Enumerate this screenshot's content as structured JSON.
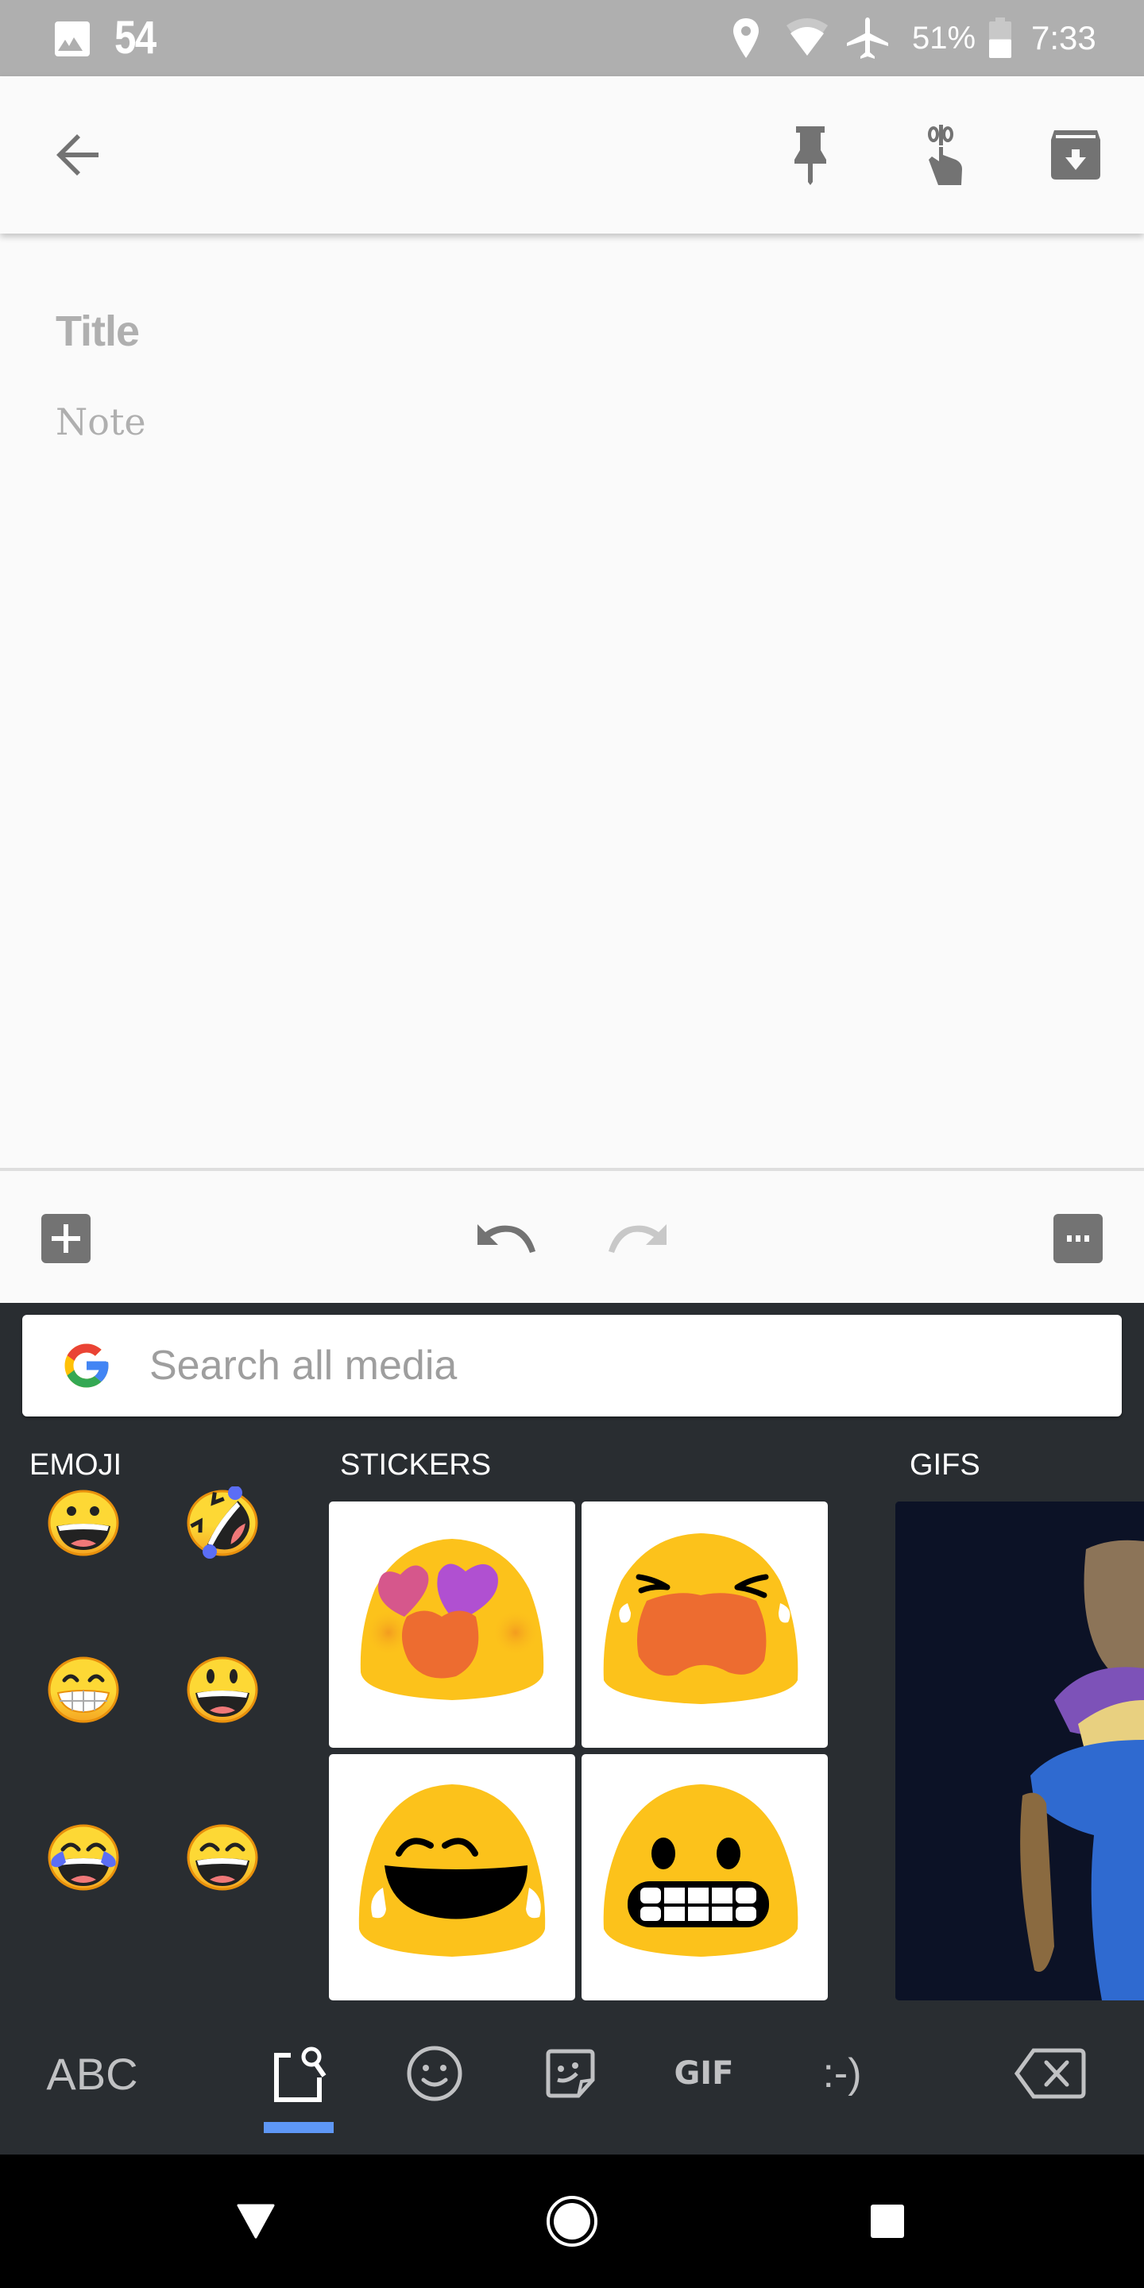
{
  "status_bar": {
    "notification_icon": "image-icon",
    "notification_count": "54",
    "icons": [
      "location-icon",
      "wifi-icon",
      "airplane-mode-icon"
    ],
    "battery_percent": "51%",
    "battery_level": 0.51,
    "time": "7:33"
  },
  "toolbar": {
    "back": "arrow-back-icon",
    "actions": [
      "pin-icon",
      "reminder-icon",
      "archive-icon"
    ]
  },
  "note": {
    "title_placeholder": "Title",
    "body_placeholder": "Note"
  },
  "action_bar": {
    "add": "add-box-icon",
    "undo": "undo-icon",
    "redo": "redo-icon",
    "more": "more-icon"
  },
  "keyboard": {
    "search_placeholder": "Search all media",
    "categories": {
      "emoji": "EMOJI",
      "stickers": "STICKERS",
      "gifs": "GIFS"
    },
    "emoji": [
      {
        "name": "grinning-face",
        "char": "😀"
      },
      {
        "name": "rolling-on-floor-laughing",
        "char": "🤣"
      },
      {
        "name": "beaming-face",
        "char": "😁"
      },
      {
        "name": "smiley-face",
        "char": "😃"
      },
      {
        "name": "tears-of-joy",
        "char": "😂"
      },
      {
        "name": "grinning-smiling-eyes",
        "char": "😄"
      }
    ],
    "stickers": [
      "heart-eyes-sticker",
      "crying-sticker",
      "laughing-tears-sticker",
      "grimacing-sticker"
    ],
    "bottom_bar": {
      "abc_label": "ABC",
      "tabs": [
        "media-search-icon",
        "emoji-icon",
        "sticker-icon",
        "gif-icon",
        "emoticon-icon"
      ],
      "gif_label": "GIF",
      "emoticon_label": ":-)",
      "active_tab": "media-search-icon",
      "backspace": "backspace-icon"
    },
    "accent_color": "#5e97f6"
  },
  "nav_bar": {
    "back": "nav-back-icon",
    "home": "nav-home-icon",
    "recents": "nav-recents-icon"
  }
}
